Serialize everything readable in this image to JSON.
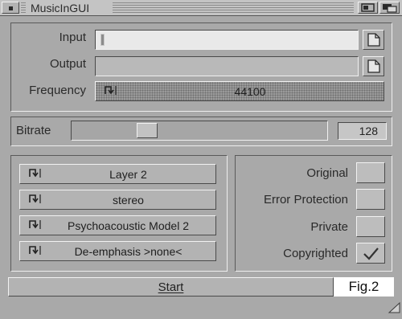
{
  "window": {
    "title": "MusicInGUI"
  },
  "io": {
    "input_label": "Input",
    "input_value": "",
    "output_label": "Output",
    "output_value": "",
    "frequency_label": "Frequency",
    "frequency_value": "44100"
  },
  "bitrate": {
    "label": "Bitrate",
    "value": "128"
  },
  "options": {
    "layer": "Layer 2",
    "mode": "stereo",
    "psy_model": "Psychoacoustic Model 2",
    "emphasis": "De-emphasis >none<"
  },
  "flags": [
    {
      "label": "Original",
      "checked": false
    },
    {
      "label": "Error Protection",
      "checked": false
    },
    {
      "label": "Private",
      "checked": false
    },
    {
      "label": "Copyrighted",
      "checked": true
    }
  ],
  "start_label": "Start",
  "figure_caption": "Fig.2",
  "icons": [
    "close-gadget-icon",
    "zoom-icon",
    "depth-icon",
    "file-requester-icon",
    "cycle-icon",
    "checkmark-icon"
  ],
  "colors": {
    "window_bg": "#a9a9a9",
    "titlebar": "#c6c6c6",
    "field_bg": "#e7e7e7"
  }
}
